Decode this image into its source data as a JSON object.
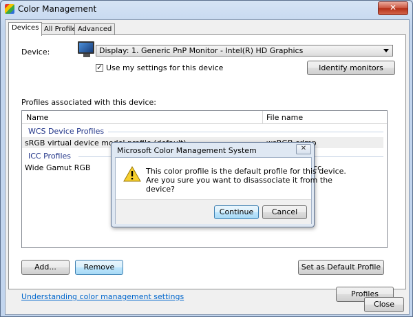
{
  "window": {
    "title": "Color Management",
    "close_glyph": "✕",
    "app_icon": "color-management-icon"
  },
  "tabs": [
    {
      "label": "Devices",
      "active": true
    },
    {
      "label": "All Profiles",
      "active": false
    },
    {
      "label": "Advanced",
      "active": false
    }
  ],
  "device": {
    "label": "Device:",
    "selected": "Display: 1. Generic PnP Monitor - Intel(R) HD Graphics",
    "use_my_settings_label": "Use my settings for this device",
    "use_my_settings_checked": true,
    "check_glyph": "✓",
    "identify_button": "Identify monitors"
  },
  "profiles": {
    "section_label": "Profiles associated with this device:",
    "columns": {
      "name": "Name",
      "file": "File name"
    },
    "groups": [
      {
        "label": "WCS Device Profiles",
        "rows": [
          {
            "name": "sRGB virtual device model profile (default)",
            "file": "wsRGB.cdmp"
          }
        ]
      },
      {
        "label": "ICC Profiles",
        "rows": [
          {
            "name": "Wide Gamut RGB",
            "file": "icc"
          }
        ]
      }
    ]
  },
  "buttons": {
    "add": "Add...",
    "remove": "Remove",
    "set_default": "Set as Default Profile",
    "profiles": "Profiles",
    "close": "Close"
  },
  "help_link": "Understanding color management settings",
  "dialog": {
    "title": "Microsoft Color Management System",
    "close_glyph": "✕",
    "icon": "warning-icon",
    "message_lines": [
      "This color profile is the default profile for this device.",
      "Are you sure you want to disassociate it from the",
      "device?"
    ],
    "continue": "Continue",
    "cancel": "Cancel"
  }
}
